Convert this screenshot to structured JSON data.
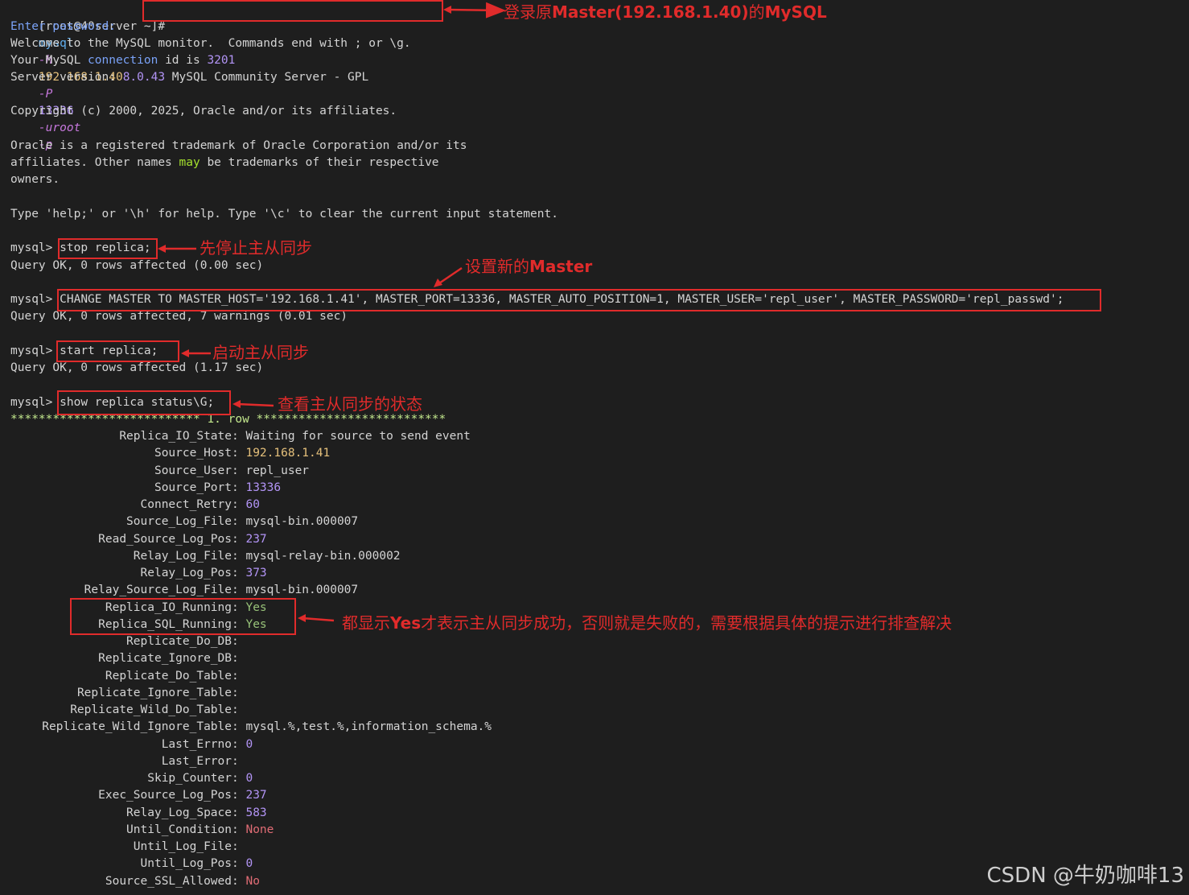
{
  "terminal": {
    "prompt_shell": "[root@40server ~]#",
    "login_cmd": {
      "mysql": "mysql",
      "h": "-h",
      "ip": "192.168.1.40",
      "P": "-P",
      "port": "13336",
      "user": "-uroot",
      "p": "-p"
    },
    "enter_password": "Enter password:",
    "welcome": "Welcome to the MySQL monitor.  Commands end with ; or \\g.",
    "connection_pre": "Your MySQL ",
    "connection_kw": "connection",
    "connection_mid": " id is ",
    "connection_id": "3201",
    "server_version_label": "Server version:",
    "server_version": "8.0.43",
    "server_version_rest": " MySQL Community Server - GPL",
    "copyright": "Copyright (c) 2000, 2025, Oracle and/or its affiliates.",
    "oracle_1": "Oracle is a registered trademark of Oracle Corporation and/or its",
    "oracle_2_a": "affiliates. Other names ",
    "oracle_2_may": "may",
    "oracle_2_b": " be trademarks of their respective",
    "oracle_3": "owners.",
    "help_line": "Type 'help;' or '\\h' for help. Type '\\c' to clear the current input statement.",
    "mysql_prompt": "mysql>",
    "stop_cmd": "stop replica;",
    "stop_result": "Query OK, 0 rows affected (0.00 sec)",
    "change_cmd": "CHANGE MASTER TO MASTER_HOST='192.168.1.41', MASTER_PORT=13336, MASTER_AUTO_POSITION=1, MASTER_USER='repl_user', MASTER_PASSWORD='repl_passwd';",
    "change_result": "Query OK, 0 rows affected, 7 warnings (0.01 sec)",
    "start_cmd": "start replica;",
    "start_result": "Query OK, 0 rows affected (1.17 sec)",
    "show_cmd": "show replica status\\G;",
    "row_header": "*************************** 1. row ***************************",
    "status_rows": [
      {
        "key": "Replica_IO_State",
        "value": "Waiting for source to send event",
        "cls": "c-user"
      },
      {
        "key": "Source_Host",
        "value": "192.168.1.41",
        "cls": "c-ip"
      },
      {
        "key": "Source_User",
        "value": "repl_user",
        "cls": "c-user"
      },
      {
        "key": "Source_Port",
        "value": "13336",
        "cls": "c-num"
      },
      {
        "key": "Connect_Retry",
        "value": "60",
        "cls": "c-num"
      },
      {
        "key": "Source_Log_File",
        "value": "mysql-bin.000007",
        "cls": "c-user"
      },
      {
        "key": "Read_Source_Log_Pos",
        "value": "237",
        "cls": "c-num"
      },
      {
        "key": "Relay_Log_File",
        "value": "mysql-relay-bin.000002",
        "cls": "c-user"
      },
      {
        "key": "Relay_Log_Pos",
        "value": "373",
        "cls": "c-num"
      },
      {
        "key": "Relay_Source_Log_File",
        "value": "mysql-bin.000007",
        "cls": "c-user"
      },
      {
        "key": "Replica_IO_Running",
        "value": "Yes",
        "cls": "c-ok"
      },
      {
        "key": "Replica_SQL_Running",
        "value": "Yes",
        "cls": "c-ok"
      },
      {
        "key": "Replicate_Do_DB",
        "value": "",
        "cls": "c-user"
      },
      {
        "key": "Replicate_Ignore_DB",
        "value": "",
        "cls": "c-user"
      },
      {
        "key": "Replicate_Do_Table",
        "value": "",
        "cls": "c-user"
      },
      {
        "key": "Replicate_Ignore_Table",
        "value": "",
        "cls": "c-user"
      },
      {
        "key": "Replicate_Wild_Do_Table",
        "value": "",
        "cls": "c-user"
      },
      {
        "key": "Replicate_Wild_Ignore_Table",
        "value": "mysql.%,test.%,information_schema.%",
        "cls": "c-user"
      },
      {
        "key": "Last_Errno",
        "value": "0",
        "cls": "c-num"
      },
      {
        "key": "Last_Error",
        "value": "",
        "cls": "c-user"
      },
      {
        "key": "Skip_Counter",
        "value": "0",
        "cls": "c-num"
      },
      {
        "key": "Exec_Source_Log_Pos",
        "value": "237",
        "cls": "c-num"
      },
      {
        "key": "Relay_Log_Space",
        "value": "583",
        "cls": "c-num"
      },
      {
        "key": "Until_Condition",
        "value": "None",
        "cls": "c-no"
      },
      {
        "key": "Until_Log_File",
        "value": "",
        "cls": "c-user"
      },
      {
        "key": "Until_Log_Pos",
        "value": "0",
        "cls": "c-num"
      },
      {
        "key": "Source_SSL_Allowed",
        "value": "No",
        "cls": "c-no"
      }
    ]
  },
  "annotations": {
    "login_pre": "登录原",
    "login_bold": "Master(192.168.1.40)",
    "login_mid": "的",
    "login_bold2": "MySQL",
    "stop": "先停止主从同步",
    "change_pre": "设置新的",
    "change_bold": "Master",
    "start": "启动主从同步",
    "show": "查看主从同步的状态",
    "yes_pre": "都显示",
    "yes_bold": "Yes",
    "yes_rest": "才表示主从同步成功，否则就是失败的，需要根据具体的提示进行排查解决"
  },
  "watermark": "CSDN @牛奶咖啡13",
  "colors": {
    "annotation": "#e02b2b",
    "background": "#1e1e1e"
  }
}
